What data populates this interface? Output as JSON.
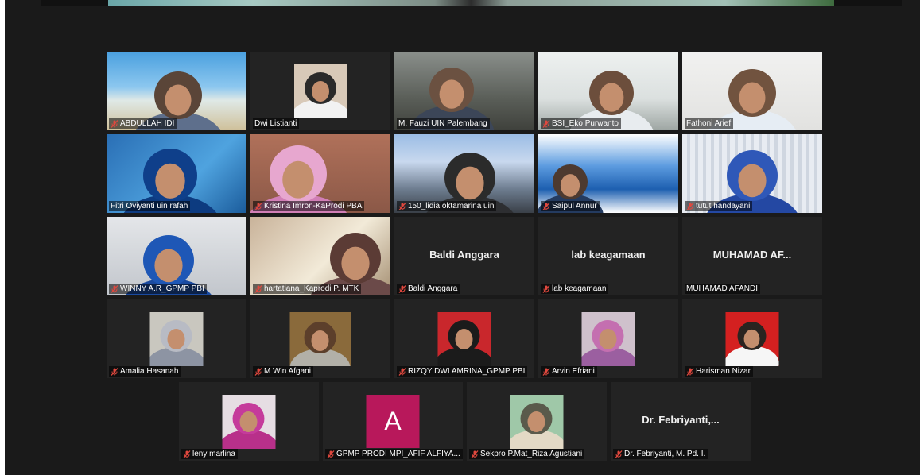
{
  "window": {
    "background": "#1a1a1a",
    "active_speaker_color": "#c7de3f",
    "muted_icon_color": "#e0483e"
  },
  "rows": [
    [
      {
        "name": "ABDULLAH IDI",
        "muted": true,
        "kind": "video",
        "scene": "beach"
      },
      {
        "name": "Dwi Listianti",
        "muted": false,
        "kind": "thumb",
        "scene": "hijab-white"
      },
      {
        "name": "M. Fauzi UIN Palembang",
        "muted": false,
        "kind": "video",
        "scene": "office-dim"
      },
      {
        "name": "BSI_Eko Purwanto",
        "muted": true,
        "kind": "video",
        "scene": "bsi-office",
        "active": true
      },
      {
        "name": "Fathoni Arief",
        "muted": false,
        "kind": "video",
        "scene": "white-wall"
      }
    ],
    [
      {
        "name": "Fitri Oviyanti uin rafah",
        "muted": false,
        "kind": "video",
        "scene": "blue-hijab"
      },
      {
        "name": "Kristina Imron-KaProdi PBA",
        "muted": true,
        "kind": "video",
        "scene": "pink-hijab"
      },
      {
        "name": "150_lidia oktamarina uin",
        "muted": true,
        "kind": "video",
        "scene": "uin-banner"
      },
      {
        "name": "Saipul Annur",
        "muted": true,
        "kind": "video",
        "scene": "uin-logo"
      },
      {
        "name": "tutut handayani",
        "muted": true,
        "kind": "video",
        "scene": "curtain"
      }
    ],
    [
      {
        "name": "WINNY A.R_GPMP PBI",
        "muted": true,
        "kind": "video",
        "scene": "headset"
      },
      {
        "name": "hartatiana_Kaprodi P. MTK",
        "muted": true,
        "kind": "video",
        "scene": "bright"
      },
      {
        "name": "Baldi Anggara",
        "muted": true,
        "kind": "name",
        "display": "Baldi Anggara"
      },
      {
        "name": "lab keagamaan",
        "muted": true,
        "kind": "name",
        "display": "lab keagamaan"
      },
      {
        "name": "MUHAMAD AFANDI",
        "muted": false,
        "kind": "name",
        "display": "MUHAMAD AF..."
      }
    ],
    [
      {
        "name": "Amalia Hasanah",
        "muted": true,
        "kind": "thumb",
        "scene": "hijab-grey"
      },
      {
        "name": "M Win Afgani",
        "muted": true,
        "kind": "thumb",
        "scene": "mask-man"
      },
      {
        "name": "RIZQY DWI AMRINA_GPMP PBI",
        "muted": true,
        "kind": "thumb",
        "scene": "red-bg"
      },
      {
        "name": "Arvin Efriani",
        "muted": true,
        "kind": "thumb",
        "scene": "purple-hijab"
      },
      {
        "name": "Harisman Nizar",
        "muted": true,
        "kind": "thumb",
        "scene": "red-man"
      }
    ],
    [
      {
        "name": "leny marlina",
        "muted": true,
        "kind": "thumb",
        "scene": "magenta-hijab"
      },
      {
        "name": "GPMP PRODI MPI_AFIF ALFIYA...",
        "muted": true,
        "kind": "letter",
        "letter": "A"
      },
      {
        "name": "Sekpro P.Mat_Riza Agustiani",
        "muted": true,
        "kind": "thumb",
        "scene": "green-hijab"
      },
      {
        "name": "Dr. Febriyanti, M. Pd. I.",
        "muted": true,
        "kind": "name",
        "display": "Dr. Febriyanti,..."
      }
    ]
  ]
}
